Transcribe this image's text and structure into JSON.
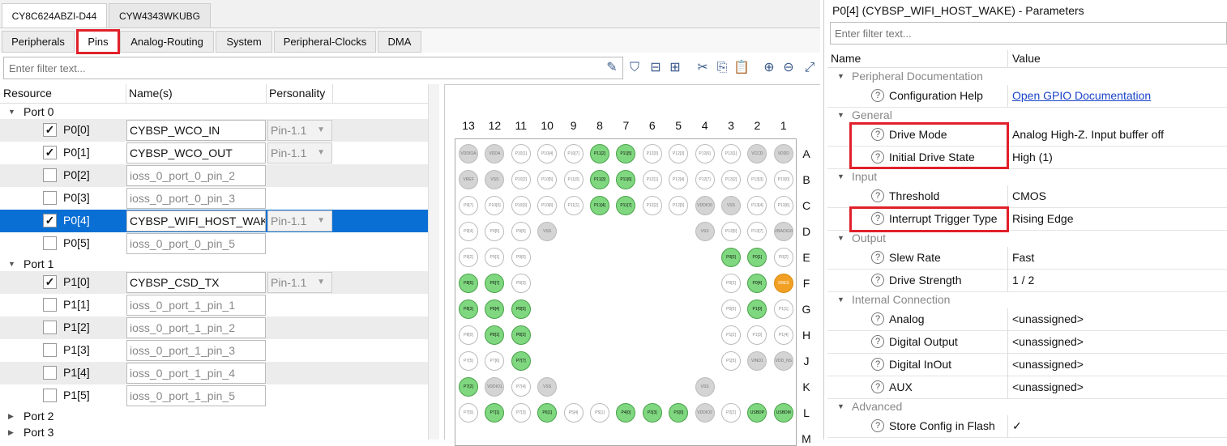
{
  "device_tabs": [
    "CY8C624ABZI-D44",
    "CYW4343WKUBG"
  ],
  "sub_tabs": [
    "Peripherals",
    "Pins",
    "Analog-Routing",
    "System",
    "Peripheral-Clocks",
    "DMA"
  ],
  "filter_placeholder": "Enter filter text...",
  "resource_columns": [
    "Resource",
    "Name(s)",
    "Personality"
  ],
  "ports": [
    {
      "label": "Port 0",
      "rows": [
        {
          "pin": "P0[0]",
          "checked": "✓",
          "name": "CYBSP_WCO_IN",
          "personality": "Pin-1.1"
        },
        {
          "pin": "P0[1]",
          "checked": "✓",
          "name": "CYBSP_WCO_OUT",
          "personality": "Pin-1.1"
        },
        {
          "pin": "P0[2]",
          "checked": "",
          "name": "ioss_0_port_0_pin_2",
          "personality": ""
        },
        {
          "pin": "P0[3]",
          "checked": "",
          "name": "ioss_0_port_0_pin_3",
          "personality": ""
        },
        {
          "pin": "P0[4]",
          "checked": "✓",
          "name": "CYBSP_WIFI_HOST_WAKE",
          "personality": "Pin-1.1"
        },
        {
          "pin": "P0[5]",
          "checked": "",
          "name": "ioss_0_port_0_pin_5",
          "personality": ""
        }
      ]
    },
    {
      "label": "Port 1",
      "rows": [
        {
          "pin": "P1[0]",
          "checked": "✓",
          "name": "CYBSP_CSD_TX",
          "personality": "Pin-1.1"
        },
        {
          "pin": "P1[1]",
          "checked": "",
          "name": "ioss_0_port_1_pin_1",
          "personality": ""
        },
        {
          "pin": "P1[2]",
          "checked": "",
          "name": "ioss_0_port_1_pin_2",
          "personality": ""
        },
        {
          "pin": "P1[3]",
          "checked": "",
          "name": "ioss_0_port_1_pin_3",
          "personality": ""
        },
        {
          "pin": "P1[4]",
          "checked": "",
          "name": "ioss_0_port_1_pin_4",
          "personality": ""
        },
        {
          "pin": "P1[5]",
          "checked": "",
          "name": "ioss_0_port_1_pin_5",
          "personality": ""
        }
      ]
    },
    {
      "label": "Port 2",
      "rows": []
    },
    {
      "label": "Port 3",
      "rows": []
    }
  ],
  "package": {
    "col_numbers": [
      "13",
      "12",
      "11",
      "10",
      "9",
      "8",
      "7",
      "6",
      "5",
      "4",
      "3",
      "2",
      "1"
    ],
    "row_letters": [
      "A",
      "B",
      "C",
      "D",
      "E",
      "F",
      "G",
      "H",
      "J",
      "K",
      "L",
      "M"
    ],
    "pins": [
      [
        "VDDIOA:gr",
        "VDDA:gr",
        "P10[1]:w",
        "P10[4]:w",
        "P10[7]:w",
        "P11[2]:g",
        "P11[5]:g",
        "P12[0]:w",
        "P12[3]:w",
        "P12[6]:w",
        "P13[1]:w",
        "VCCD:gr",
        "VDDD:gr"
      ],
      [
        "VREF:gr",
        "VSS:gr",
        "P10[2]:w",
        "P10[5]:w",
        "P11[0]:w",
        "P11[3]:g",
        "P11[6]:g",
        "P12[1]:w",
        "P12[4]:w",
        "P12[7]:w",
        "P13[2]:w",
        "P13[3]:w",
        "P13[0]:w"
      ],
      [
        "P9[7]:w",
        "P10[0]:w",
        "P10[3]:w",
        "P10[6]:w",
        "P11[1]:w",
        "P11[4]:g",
        "P11[7]:g",
        "P12[2]:w",
        "P12[5]:w",
        "VDDIO0:gr",
        "VSS:gr",
        "P13[4]:w",
        "P13[6]:w"
      ],
      [
        "P9[4]:w",
        "P9[5]:w",
        "P9[6]:w",
        "VSS:gr",
        "",
        "",
        "",
        "",
        "",
        "VSS:gr",
        "P13[5]:w",
        "P13[7]:w",
        "VBACKUP:gr"
      ],
      [
        "P9[2]:w",
        "P9[1]:w",
        "P9[0]:w",
        "",
        "",
        "",
        "",
        "",
        "",
        "",
        "P0[0]:g",
        "P0[1]:g",
        "P0[2]:w"
      ],
      [
        "P8[6]:g",
        "P8[7]:g",
        "P9[3]:w",
        "",
        "",
        "",
        "",
        "",
        "",
        "",
        "P0[3]:w",
        "P0[4]:g",
        "XRES:o"
      ],
      [
        "P8[3]:g",
        "P8[4]:g",
        "P8[5]:g",
        "",
        "",
        "",
        "",
        "",
        "",
        "",
        "P0[5]:w",
        "P1[0]:g",
        "P1[1]:w"
      ],
      [
        "P8[0]:w",
        "P8[1]:g",
        "P8[2]:g",
        "",
        "",
        "",
        "",
        "",
        "",
        "",
        "P1[2]:w",
        "P1[3]:w",
        "P1[4]:w"
      ],
      [
        "P7[5]:w",
        "P7[6]:w",
        "P7[7]:g",
        "",
        "",
        "",
        "",
        "",
        "",
        "",
        "P1[5]:w",
        "VIND1:gr",
        "VDD_NS:gr"
      ],
      [
        "P7[2]:g",
        "VDDIO1:gr",
        "P7[4]:w",
        "VSS:gr",
        "",
        "",
        "",
        "",
        "",
        "VSS:gr",
        "",
        "",
        ""
      ],
      [
        "P7[0]:w",
        "P7[1]:g",
        "P7[3]:w",
        "P6[1]:g",
        "P5[4]:w",
        "P5[1]:w",
        "P4[0]:g",
        "P3[3]:g",
        "P3[0]:g",
        "VDDIO2:gr",
        "P2[2]:w",
        "USBDP:g",
        "USBDM:g"
      ]
    ]
  },
  "params": {
    "title": "P0[4] (CYBSP_WIFI_HOST_WAKE) - Parameters",
    "filter_placeholder": "Enter filter text...",
    "columns": [
      "Name",
      "Value"
    ],
    "groups": [
      {
        "label": "Peripheral Documentation",
        "items": [
          {
            "name": "Configuration Help",
            "value": "Open GPIO Documentation",
            "link": true
          }
        ]
      },
      {
        "label": "General",
        "items": [
          {
            "name": "Drive Mode",
            "value": "Analog High-Z. Input buffer off"
          },
          {
            "name": "Initial Drive State",
            "value": "High (1)"
          }
        ]
      },
      {
        "label": "Input",
        "items": [
          {
            "name": "Threshold",
            "value": "CMOS"
          },
          {
            "name": "Interrupt Trigger Type",
            "value": "Rising Edge"
          }
        ]
      },
      {
        "label": "Output",
        "items": [
          {
            "name": "Slew Rate",
            "value": "Fast"
          },
          {
            "name": "Drive Strength",
            "value": "1 / 2"
          }
        ]
      },
      {
        "label": "Internal Connection",
        "items": [
          {
            "name": "Analog",
            "value": "<unassigned>"
          },
          {
            "name": "Digital Output",
            "value": "<unassigned>"
          },
          {
            "name": "Digital InOut",
            "value": "<unassigned>"
          },
          {
            "name": "AUX",
            "value": "<unassigned>"
          }
        ]
      },
      {
        "label": "Advanced",
        "items": [
          {
            "name": "Store Config in Flash",
            "value": "✓"
          }
        ]
      }
    ]
  },
  "colors": {
    "accent": "#0a6fd4",
    "highlight": "#e0202a",
    "pin_green": "#7fd87f",
    "pin_orange": "#f2a024"
  }
}
